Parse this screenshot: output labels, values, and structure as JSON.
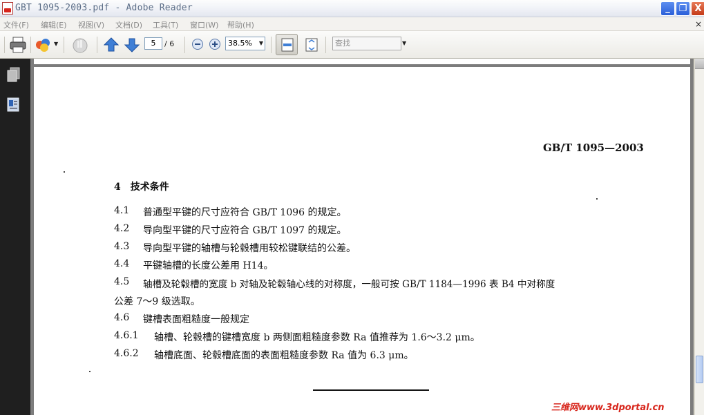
{
  "window": {
    "title": "GBT 1095-2003.pdf - Adobe Reader",
    "controls": {
      "minimize": "_",
      "maximize": "❐",
      "close": "X"
    }
  },
  "menubar": {
    "items": [
      "文件(F)",
      "编辑(E)",
      "视图(V)",
      "文档(D)",
      "工具(T)",
      "窗口(W)",
      "帮助(H)"
    ],
    "close_glyph": "×"
  },
  "toolbar": {
    "page_current": "5",
    "page_total": "/ 6",
    "zoom": "38.5%",
    "search_placeholder": "查找",
    "icons": [
      "print-icon",
      "share-icon",
      "hand-icon",
      "prev-page-icon",
      "next-page-icon",
      "zoom-out-icon",
      "zoom-in-icon",
      "fit-width-icon",
      "fit-page-icon"
    ]
  },
  "sidebar": {
    "icons": [
      "pages-icon",
      "bookmarks-icon"
    ]
  },
  "document": {
    "standard_code": "GB/T 1095—2003",
    "section_title": "4　技术条件",
    "lines": [
      {
        "num": "4.1",
        "text": "普通型平键的尺寸应符合 GB/T 1096 的规定。"
      },
      {
        "num": "4.2",
        "text": "导向型平键的尺寸应符合 GB/T 1097 的规定。"
      },
      {
        "num": "4.3",
        "text": "导向型平键的轴槽与轮毂槽用较松键联结的公差。"
      },
      {
        "num": "4.4",
        "text": "平键轴槽的长度公差用 H14。"
      },
      {
        "num": "4.5",
        "text": "轴槽及轮毂槽的宽度 b 对轴及轮毂轴心线的对称度，一般可按 GB/T 1184—1996 表 B4 中对称度"
      },
      {
        "num": "",
        "text": "公差 7～9 级选取。"
      },
      {
        "num": "4.6",
        "text": "键槽表面粗糙度一般规定"
      },
      {
        "num": "4.6.1",
        "text": "轴槽、轮毂槽的键槽宽度 b 两侧面粗糙度参数 Ra 值推荐为 1.6～3.2 μm。"
      },
      {
        "num": "4.6.2",
        "text": "轴槽底面、轮毂槽底面的表面粗糙度参数 Ra 值为 6.3 μm。"
      }
    ]
  },
  "watermark": "三维网www.3dportal.cn",
  "colors": {
    "watermark": "#d8271d",
    "sidebar": "#1f1f1f",
    "doc_bg": "#7c7c7c"
  }
}
